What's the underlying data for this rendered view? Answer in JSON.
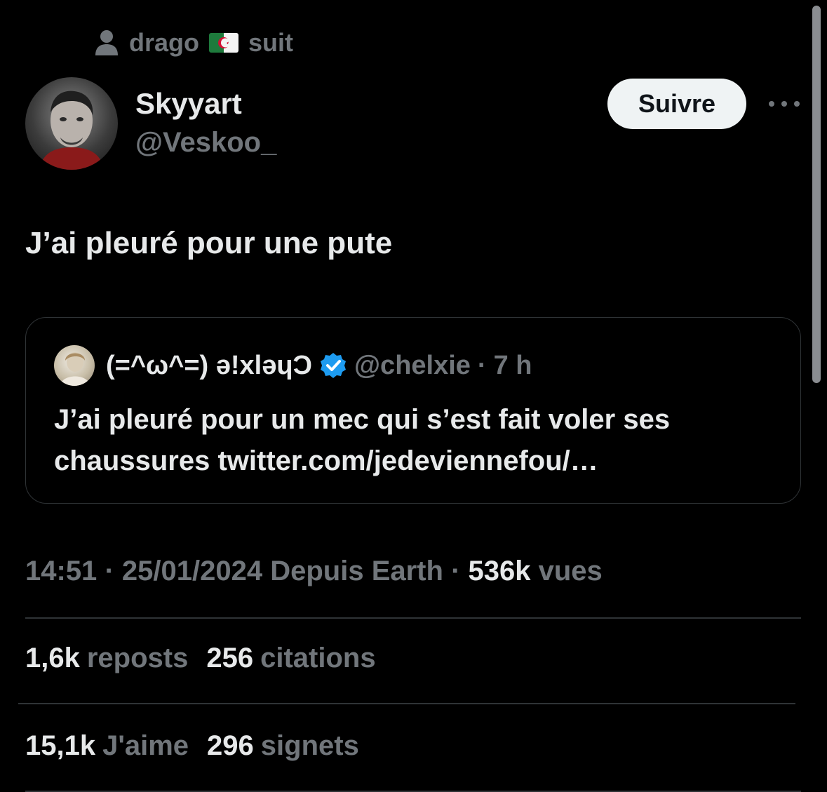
{
  "social_context": {
    "name": "drago",
    "flag": "algeria-flag",
    "label": "suit"
  },
  "author": {
    "display_name": "Skyyart",
    "handle": "@Veskoo_"
  },
  "follow_button_label": "Suivre",
  "tweet_text": "J’ai pleuré pour une pute",
  "quote": {
    "display_name": "(=^ω^=) ə!xlǝɥƆ",
    "handle": "@chelxie",
    "separator": "·",
    "time": "7 h",
    "text": "J’ai pleuré pour un mec qui s’est fait voler ses chaussures twitter.com/jedeviennefou/…",
    "verified_color": "#1d9bf0"
  },
  "meta": {
    "time": "14:51",
    "sep1": "·",
    "date": "25/01/2024",
    "source": "Depuis Earth",
    "sep2": "·",
    "views_count": "536k",
    "views_label": "vues"
  },
  "stats_row1": [
    {
      "count": "1,6k",
      "label": "reposts"
    },
    {
      "count": "256",
      "label": "citations"
    }
  ],
  "stats_row2": [
    {
      "count": "15,1k",
      "label": "J'aime"
    },
    {
      "count": "296",
      "label": "signets"
    }
  ],
  "colors": {
    "background": "#000000",
    "primary_text": "#e7e9ea",
    "secondary_text": "#71767b",
    "border": "#2f3336",
    "follow_bg": "#eff3f4"
  }
}
